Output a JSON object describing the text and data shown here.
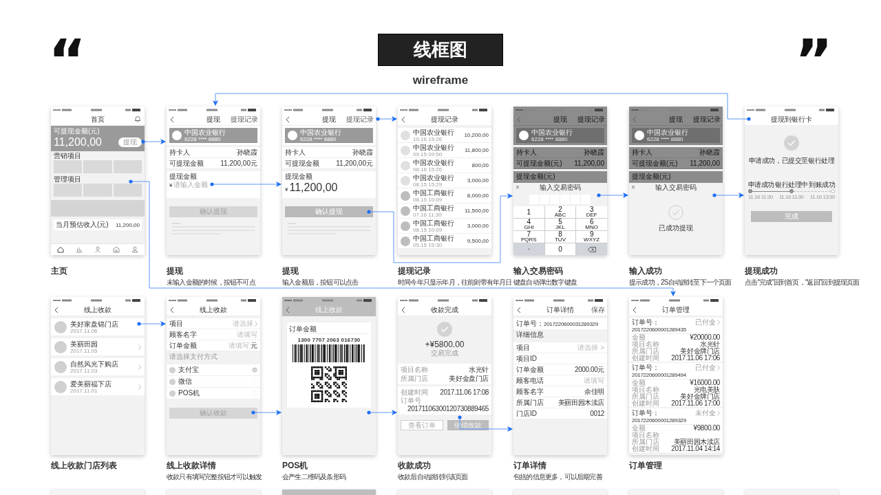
{
  "header": {
    "open_quote": "“",
    "title": "线框图",
    "subtitle": "wireframe",
    "close_quote": "”"
  },
  "rows": [
    {
      "screens": [
        {
          "kind": "home",
          "nav": {
            "title": "首页",
            "back": false
          },
          "balance_label": "可提现金额(元)",
          "balance": "11,200,00",
          "withdraw_button": "提现",
          "sections": [
            "营销项目",
            "管理项目"
          ],
          "income_label": "当月预估收入(元)",
          "income": "11,200,00",
          "caption": {
            "title": "主页"
          }
        },
        {
          "kind": "withdraw",
          "dimmed": false,
          "nav": {
            "title": "提现",
            "back": true,
            "action": "提现记录"
          },
          "card": {
            "bank": "中国农业银行",
            "number": "6228 **** 8880"
          },
          "rows": [
            {
              "label": "持卡人",
              "value": "孙晓霞"
            },
            {
              "label": "可提现金额",
              "value": "11,200,00元"
            }
          ],
          "amount_label": "提现金额",
          "currency": "¥",
          "amount_placeholder": "请输入金额",
          "confirm": {
            "label": "确认提现",
            "disabled": true
          },
          "caption": {
            "title": "提现",
            "text": "未输入金额的时候，按钮不可点"
          }
        },
        {
          "kind": "withdraw",
          "dimmed": false,
          "nav": {
            "title": "提现",
            "back": true,
            "action": "提现记录"
          },
          "card": {
            "bank": "中国农业银行",
            "number": "6228 **** 8880"
          },
          "rows": [
            {
              "label": "持卡人",
              "value": "孙晓霞"
            },
            {
              "label": "可提现金额",
              "value": "11,200,00元"
            }
          ],
          "amount_label": "提现金额",
          "currency": "¥",
          "amount": "11,200,00",
          "confirm": {
            "label": "确认提现",
            "disabled": false
          },
          "caption": {
            "title": "提现",
            "text": "输入金额后，按钮可以点击"
          }
        },
        {
          "kind": "records",
          "nav": {
            "title": "提现记录",
            "back": true
          },
          "records": [
            {
              "bank": "中国农业银行",
              "date": "10.16 15:26",
              "amount": "10,200,00",
              "color": "#e0e0e0"
            },
            {
              "bank": "中国农业银行",
              "date": "09.15 09:50",
              "amount": "11,800,00",
              "color": "#e0e0e0"
            },
            {
              "bank": "中国农业银行",
              "date": "08.16 15:26",
              "amount": "800,00",
              "color": "#e0e0e0"
            },
            {
              "bank": "中国农业银行",
              "date": "08.15 15:29",
              "amount": "3,000,00",
              "color": "#e0e0e0"
            },
            {
              "bank": "中国工商银行",
              "date": "08.15 10:09",
              "amount": "8,000,00",
              "color": "#bdbdbd"
            },
            {
              "bank": "中国工商银行",
              "date": "07.16 11:30",
              "amount": "11,500,00",
              "color": "#bdbdbd"
            },
            {
              "bank": "中国工商银行",
              "date": "08.15 10:09",
              "amount": "3,000,00",
              "color": "#bdbdbd"
            },
            {
              "bank": "中国工商银行",
              "date": "05.15 15:30",
              "amount": "9,500,00",
              "color": "#bdbdbd"
            }
          ],
          "caption": {
            "title": "提现记录",
            "text": "时间今年只显示年月，往前则带有年月日"
          }
        },
        {
          "kind": "withdraw",
          "dimmed": true,
          "nav": {
            "title": "提现",
            "back": true,
            "action": "提现记录"
          },
          "card": {
            "bank": "中国农业银行",
            "number": "6228 **** 8880"
          },
          "rows": [
            {
              "label": "持卡人",
              "value": "孙晓霞"
            },
            {
              "label": "可提现金额(元)",
              "value": "11,200,00"
            }
          ],
          "amount_label": "提现金额(元)",
          "sheet": {
            "kind": "keypad",
            "close": "×",
            "title": "输入交易密码",
            "keys": [
              {
                "kind": "digit",
                "label": "1"
              },
              {
                "kind": "digit",
                "label": "2",
                "letters": "ABC"
              },
              {
                "kind": "digit",
                "label": "3",
                "letters": "DEF"
              },
              {
                "kind": "digit",
                "label": "4",
                "letters": "GHI"
              },
              {
                "kind": "digit",
                "label": "5",
                "letters": "JKL"
              },
              {
                "kind": "digit",
                "label": "6",
                "letters": "MNO"
              },
              {
                "kind": "digit",
                "label": "7",
                "letters": "PQRS"
              },
              {
                "kind": "digit",
                "label": "8",
                "letters": "TUV"
              },
              {
                "kind": "digit",
                "label": "9",
                "letters": "WXYZ"
              },
              {
                "kind": "function",
                "label": "."
              },
              {
                "kind": "digit",
                "label": "0"
              },
              {
                "kind": "delete"
              }
            ]
          },
          "caption": {
            "title": "输入交易密码",
            "text": "键盘自动弹出数字键盘"
          }
        },
        {
          "kind": "withdraw",
          "dimmed": true,
          "nav": {
            "title": "提现",
            "back": true,
            "action": "提现记录"
          },
          "card": {
            "bank": "中国农业银行",
            "number": "6228 **** 8880"
          },
          "rows": [
            {
              "label": "持卡人",
              "value": "孙晓霞"
            },
            {
              "label": "可提现金额(元)",
              "value": "11,200,00"
            }
          ],
          "amount_label": "提现金额(元)",
          "sheet": {
            "kind": "success",
            "close": "×",
            "title": "输入交易密码",
            "message": "已成功提现"
          },
          "caption": {
            "title": "输入成功",
            "text": "提示成功，2S自动跳转至下一个页面"
          }
        },
        {
          "kind": "result",
          "nav": {
            "title": "提现到银行卡",
            "back": false
          },
          "message": "申请成功，已提交至银行处理",
          "steps": [
            {
              "label": "申请成功",
              "time": "11.16 11:30",
              "done": true
            },
            {
              "label": "银行处理中",
              "time": "11.16 11:30",
              "done": true
            },
            {
              "label": "到账成功",
              "time": "11.16 13:30",
              "done": false
            }
          ],
          "done_button": "完成",
          "caption": {
            "title": "提现成功",
            "text": "点击“完成”回到首页，“返回”回到提现页面"
          }
        }
      ]
    },
    {
      "screens": [
        {
          "kind": "store_list",
          "nav": {
            "title": "线上收款",
            "back": true
          },
          "stores": [
            {
              "name": "美好家盘锦门店",
              "date": "2017.11.06"
            },
            {
              "name": "美丽田园",
              "date": "2017.11.05"
            },
            {
              "name": "自然风光下购店",
              "date": "2017.11.03"
            },
            {
              "name": "爱美丽福下店",
              "date": "2017.11.01"
            }
          ],
          "caption": {
            "title": "线上收款门店列表"
          }
        },
        {
          "kind": "payment_form",
          "nav": {
            "title": "线上收款",
            "back": true
          },
          "fields": [
            {
              "kind": "select",
              "label": "项目",
              "placeholder": "请选择"
            },
            {
              "kind": "text",
              "label": "顾客名字",
              "placeholder": "请填写"
            },
            {
              "kind": "text",
              "label": "订单金额",
              "placeholder": "请填写",
              "unit": "元"
            }
          ],
          "methods_label": "请选择支付方式",
          "methods": [
            {
              "name": "支付宝",
              "selected": true
            },
            {
              "name": "微信",
              "selected": false
            },
            {
              "name": "POS机",
              "selected": false
            }
          ],
          "confirm": "确认收款",
          "caption": {
            "title": "线上收款详情",
            "text": "收款只有填写完整按钮才可以触发"
          }
        },
        {
          "kind": "pos",
          "nav": {
            "title": "线上收款",
            "back": true
          },
          "amount_label": "订单金额",
          "barcode_number": "1300 7707 2063 016730",
          "caption": {
            "title": "POS机",
            "text": "会产生二维码及条形码"
          }
        },
        {
          "kind": "payment_done",
          "nav": {
            "title": "收款完成",
            "back": true
          },
          "amount": "+¥5800.00",
          "status": "交易完成",
          "details": [
            {
              "rows": [
                {
                  "label": "项目名称",
                  "value": "水光针"
                },
                {
                  "label": "所属门店",
                  "value": "美好金盘门店"
                }
              ]
            },
            {
              "rows": [
                {
                  "label": "创建时间",
                  "value": "2017.11.06 17:08"
                },
                {
                  "label": "订单号",
                  "value": "20171106300120730889465"
                }
              ]
            }
          ],
          "buttons": [
            {
              "kind": "outline",
              "label": "查看订单"
            },
            {
              "kind": "filled",
              "label": "继续收款"
            }
          ],
          "caption": {
            "title": "收款成功",
            "text": "收款后自动跳转到该页面"
          }
        },
        {
          "kind": "order_detail",
          "nav": {
            "title": "订单详情",
            "back": true,
            "action": "保存"
          },
          "number_label": "订单号：",
          "number": "2017220600031289329",
          "section": "详细信息",
          "rows": [
            {
              "label": "项目",
              "placeholder": "请选择 >"
            },
            {
              "label": "项目ID"
            },
            {
              "label": "订单金额",
              "value": "2000.00元"
            },
            {
              "label": "顾客电话",
              "placeholder": "请填写"
            },
            {
              "label": "顾客名字",
              "value": "余佳明"
            },
            {
              "label": "所属门店",
              "value": "美丽田园木渎店"
            },
            {
              "label": "门店ID",
              "value": "0012"
            }
          ],
          "caption": {
            "title": "订单详情",
            "text": "包括的信息更多，可以后期完善"
          }
        },
        {
          "kind": "order_list",
          "nav": {
            "title": "订单管理",
            "back": true
          },
          "orders": [
            {
              "number_label": "订单号：",
              "number": "2017220600001289435",
              "status": "已付全",
              "rows": [
                {
                  "label": "金额",
                  "value": "¥20000.00"
                },
                {
                  "label": "项目名称",
                  "value": "水光针"
                },
                {
                  "label": "所属门店",
                  "value": "美好金牌门店"
                },
                {
                  "label": "创建时间",
                  "value": "2017.11.06 17:06"
                }
              ]
            },
            {
              "number_label": "订单号：",
              "number": "2017220600001289494",
              "status": "已付全",
              "rows": [
                {
                  "label": "金额",
                  "value": "¥16000.00"
                },
                {
                  "label": "项目名称",
                  "value": "光电美肤"
                },
                {
                  "label": "所属门店",
                  "value": "美好金牌门店"
                },
                {
                  "label": "创建时间",
                  "value": "2017.11.06 17:00"
                }
              ]
            },
            {
              "number_label": "订单号：",
              "number": "2017220600001289329",
              "status": "未付全",
              "rows": [
                {
                  "label": "金额",
                  "value": "¥9800.00"
                },
                {
                  "label": "项目名称"
                },
                {
                  "label": "所属门店",
                  "value": "美丽田园木渎店"
                },
                {
                  "label": "创建时间",
                  "value": "2017.11.04 14:14"
                }
              ]
            }
          ],
          "caption": {
            "title": "订单管理"
          }
        }
      ]
    }
  ],
  "next_row": {
    "screens": [
      {
        "kind": "light"
      },
      {
        "kind": "light"
      },
      {
        "kind": "grey"
      },
      {
        "kind": "light"
      },
      {
        "kind": "light"
      },
      {
        "kind": "light"
      },
      {
        "kind": "light"
      }
    ]
  }
}
